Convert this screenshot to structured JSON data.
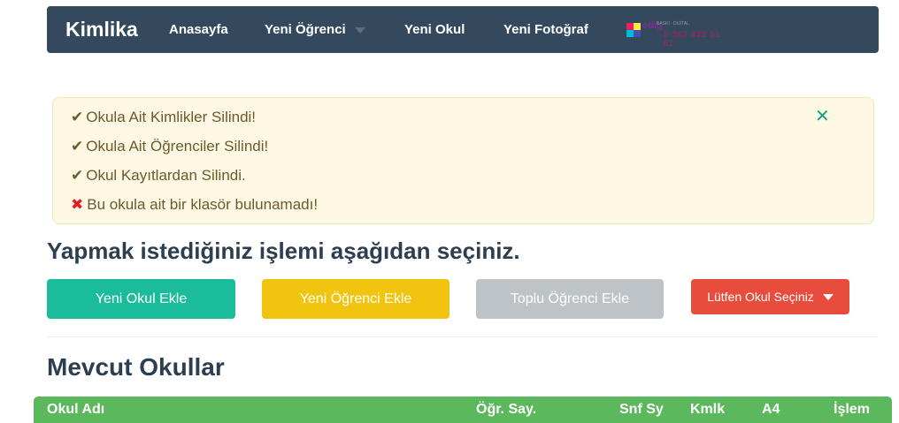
{
  "navbar": {
    "brand": "Kimlika",
    "items": [
      {
        "label": "Anasayfa"
      },
      {
        "label": "Yeni Öğrenci"
      },
      {
        "label": "Yeni Okul"
      },
      {
        "label": "Yeni Fotoğraf"
      }
    ],
    "logo": {
      "name": "edig",
      "sub": "BASKI · DİJİTAL",
      "phone": "0 362 432 51 51"
    }
  },
  "alert": {
    "messages": [
      {
        "status": "success",
        "icon": "✔",
        "text": "Okula Ait Kimlikler Silindi!"
      },
      {
        "status": "success",
        "icon": "✔",
        "text": "Okula Ait Öğrenciler Silindi!"
      },
      {
        "status": "success",
        "icon": "✔",
        "text": "Okul Kayıtlardan Silindi."
      },
      {
        "status": "error",
        "icon": "✖",
        "text": "Bu okula ait bir klasör bulunamadı!"
      }
    ],
    "close_icon": "✕"
  },
  "main": {
    "heading": "Yapmak istediğiniz işlemi aşağıdan seçiniz.",
    "buttons": {
      "add_school": "Yeni Okul Ekle",
      "add_student": "Yeni Öğrenci Ekle",
      "bulk_add_student": "Toplu Öğrenci Ekle",
      "select_school": "Lütfen Okul Seçiniz"
    },
    "section_title": "Mevcut Okullar",
    "table": {
      "columns": [
        "Okul Adı",
        "Öğr. Say.",
        "Snf Sy",
        "Kmlk",
        "A4",
        "İşlem"
      ]
    }
  },
  "colors": {
    "navbar": "#34495e",
    "alert_bg": "#fcf8e3",
    "btn_green": "#1abc9c",
    "btn_yellow": "#f1c40f",
    "btn_gray": "#bdc3c7",
    "btn_red": "#e74c3c",
    "table_header": "#5cb85c"
  }
}
